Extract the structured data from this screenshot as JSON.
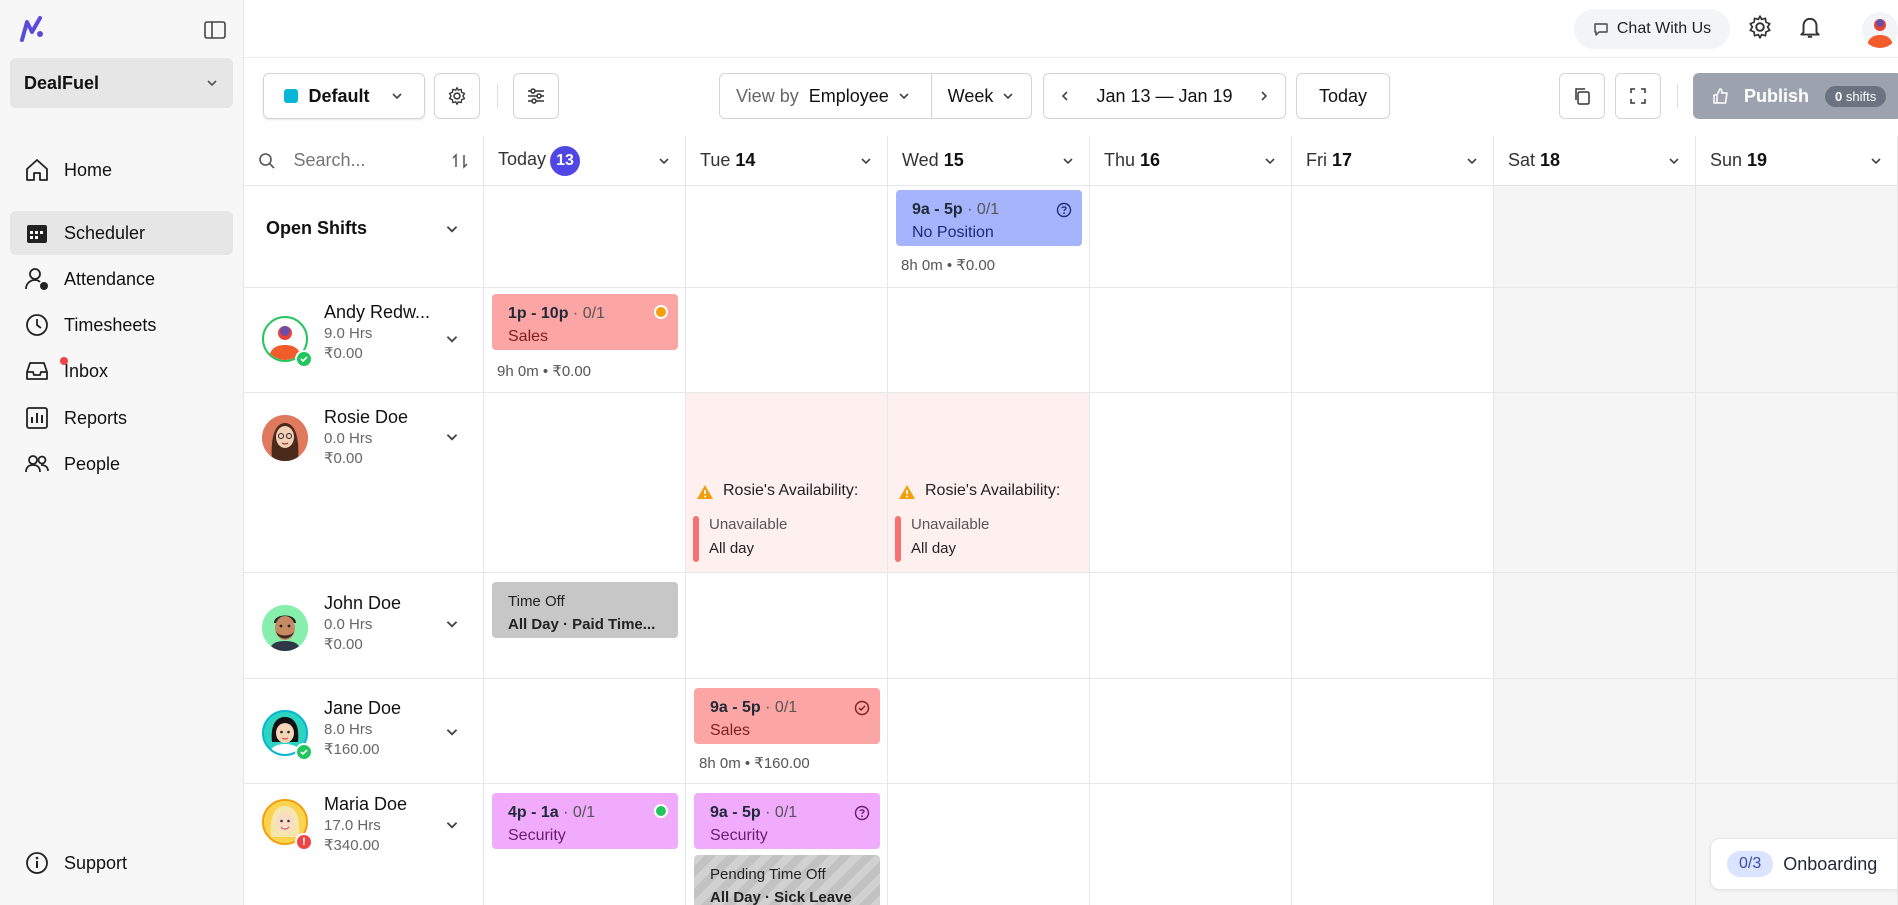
{
  "sidebar": {
    "company": "DealFuel",
    "items": [
      {
        "label": "Home",
        "icon": "home-icon"
      },
      {
        "label": "Scheduler",
        "icon": "calendar-icon"
      },
      {
        "label": "Attendance",
        "icon": "attendance-icon"
      },
      {
        "label": "Timesheets",
        "icon": "clock-icon"
      },
      {
        "label": "Inbox",
        "icon": "inbox-icon"
      },
      {
        "label": "Reports",
        "icon": "reports-icon"
      },
      {
        "label": "People",
        "icon": "people-icon"
      }
    ],
    "support": "Support"
  },
  "topbar": {
    "chat": "Chat With Us"
  },
  "toolbar": {
    "schedule": "Default",
    "schedule_color": "#06b6d4",
    "view_by_label": "View by",
    "view_by_value": "Employee",
    "range_mode": "Week",
    "date_range": "Jan 13 — Jan 19",
    "today": "Today",
    "publish": "Publish",
    "publish_count": "0",
    "publish_unit": "shifts"
  },
  "grid": {
    "search_placeholder": "Search...",
    "days": [
      {
        "name": "Today",
        "num": "13"
      },
      {
        "name": "Tue",
        "num": "14"
      },
      {
        "name": "Wed",
        "num": "15"
      },
      {
        "name": "Thu",
        "num": "16"
      },
      {
        "name": "Fri",
        "num": "17"
      },
      {
        "name": "Sat",
        "num": "18"
      },
      {
        "name": "Sun",
        "num": "19"
      }
    ],
    "open_shifts": {
      "label": "Open Shifts",
      "shift": {
        "time": "9a - 5p",
        "count": "· 0/1",
        "position": "No Position",
        "meta": "8h 0m • ₹0.00"
      }
    },
    "employees": [
      {
        "name": "Andy Redw...",
        "hrs": "9.0 Hrs",
        "pay": "₹0.00"
      },
      {
        "name": "Rosie Doe",
        "hrs": "0.0 Hrs",
        "pay": "₹0.00"
      },
      {
        "name": "John Doe",
        "hrs": "0.0 Hrs",
        "pay": "₹0.00"
      },
      {
        "name": "Jane Doe",
        "hrs": "8.0 Hrs",
        "pay": "₹160.00"
      },
      {
        "name": "Maria Doe",
        "hrs": "17.0 Hrs",
        "pay": "₹340.00"
      }
    ],
    "andy_shift": {
      "time": "1p - 10p",
      "count": "· 0/1",
      "position": "Sales",
      "meta": "9h 0m • ₹0.00"
    },
    "rosie_avail": {
      "title": "Rosie's Availability:",
      "status": "Unavailable",
      "period": "All day"
    },
    "john_timeoff": {
      "title": "Time Off",
      "detail": "All Day · Paid Time..."
    },
    "jane_shift": {
      "time": "9a - 5p",
      "count": "· 0/1",
      "position": "Sales",
      "meta": "8h 0m • ₹160.00"
    },
    "maria_shift1": {
      "time": "4p - 1a",
      "count": "· 0/1",
      "position": "Security"
    },
    "maria_shift2": {
      "time": "9a - 5p",
      "count": "· 0/1",
      "position": "Security"
    },
    "maria_pending": {
      "title": "Pending Time Off",
      "detail": "All Day · Sick Leave"
    }
  },
  "onboarding": {
    "progress": "0/3",
    "label": "Onboarding"
  }
}
